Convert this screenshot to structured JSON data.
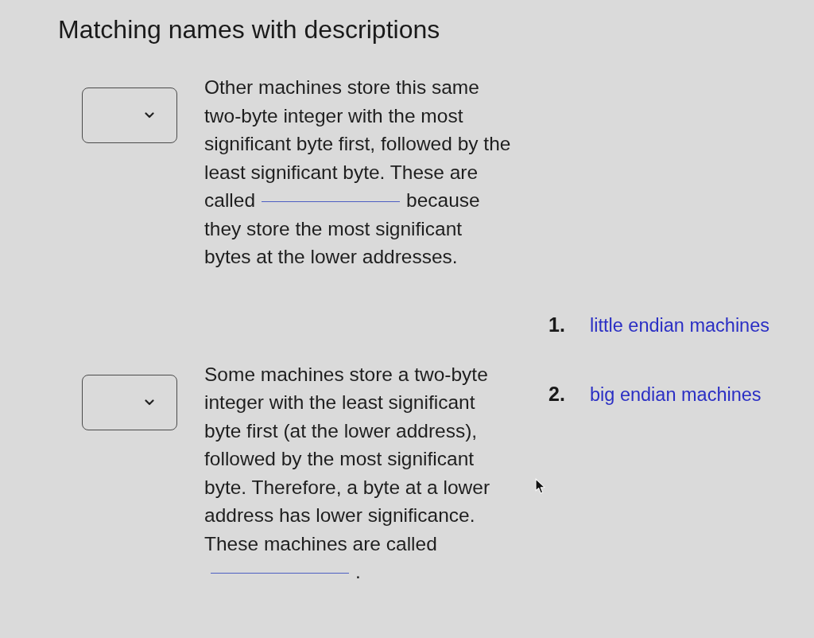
{
  "heading": "Matching names with descriptions",
  "questions": [
    {
      "text_before": "Other machines store this same\ntwo-byte integer with the most\nsignificant byte first, followed by the\nleast significant byte. These are\ncalled",
      "text_after": "because\nthey store the most significant\nbytes at the lower addresses."
    },
    {
      "text_before": "Some machines store a two-byte\ninteger with the least significant\nbyte first (at the lower address),\nfollowed by the most significant\nbyte. Therefore, a byte at a lower\naddress has lower significance.\nThese machines are called\n",
      "text_after": "."
    }
  ],
  "answers": [
    {
      "number": "1.",
      "text": "little endian machines"
    },
    {
      "number": "2.",
      "text": "big endian machines"
    }
  ]
}
